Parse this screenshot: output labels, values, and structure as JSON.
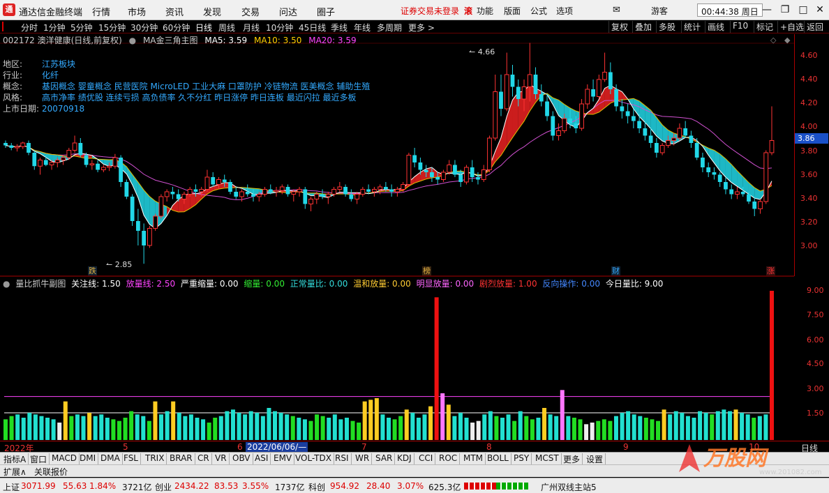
{
  "menubar": {
    "logo": "通",
    "title": "通达信金融终端",
    "items": [
      "行情",
      "市场",
      "资讯",
      "发现",
      "交易",
      "问达",
      "圈子"
    ],
    "warning": "证券交易未登录",
    "func_badge": "滚",
    "right_items": [
      "功能",
      "版面",
      "公式",
      "选项",
      "游客"
    ],
    "clock": "00:44:38 周日"
  },
  "toolbar": {
    "periods": [
      "分时",
      "1分钟",
      "5分钟",
      "15分钟",
      "30分钟",
      "60分钟",
      "日线",
      "周线",
      "月线",
      "10分钟",
      "45日线",
      "季线",
      "年线",
      "多周期",
      "更多 >"
    ],
    "active": "日线",
    "right": [
      "复权",
      "叠加",
      "多股",
      "统计",
      "画线",
      "F10",
      "标记",
      "+自选",
      "返回"
    ]
  },
  "mainhead": {
    "stock": "002172 澳洋健康(日线,前复权)",
    "indicator": "MA金三角主图",
    "ma5": "MA5: 3.59",
    "ma10": "MA10: 3.50",
    "ma20": "MA20: 3.59"
  },
  "info": {
    "rows": [
      {
        "k": "地区:",
        "v": "江苏板块"
      },
      {
        "k": "行业:",
        "v": "化纤"
      },
      {
        "k": "概念:",
        "v": "基因概念 婴童概念 民营医院 MicroLED 工业大麻 口罩防护 冷链物流 医美概念 辅助生殖"
      },
      {
        "k": "风格:",
        "v": "高市净率 绩优股 连续亏损 高负债率 久不分红 昨日涨停 昨日连板 最近闪拉 最近多板"
      },
      {
        "k": "上市日期:",
        "v": "20070918"
      }
    ]
  },
  "price_axis": {
    "ticks": [
      "4.60",
      "4.40",
      "4.20",
      "4.00",
      "3.80",
      "3.60",
      "3.40",
      "3.20",
      "3.00"
    ],
    "current": "3.86",
    "high_label": "4.66",
    "low_label": "2.85"
  },
  "markers": [
    {
      "text": "跌",
      "color": "#e0b040"
    },
    {
      "text": "榜",
      "color": "#e0b040"
    },
    {
      "text": "财",
      "color": "#33aaff"
    },
    {
      "text": "涨",
      "color": "#ff3333"
    }
  ],
  "subhead": {
    "name": "量比抓牛副图",
    "items": [
      {
        "t": "关注线: 1.50",
        "c": "#ffffff"
      },
      {
        "t": "放量线: 2.50",
        "c": "#ff44ff"
      },
      {
        "t": "严重缩量: 0.00",
        "c": "#ffffff"
      },
      {
        "t": "缩量: 0.00",
        "c": "#33ee33"
      },
      {
        "t": "正常量比: 0.00",
        "c": "#33dddd"
      },
      {
        "t": "温和放量: 0.00",
        "c": "#ffcc33"
      },
      {
        "t": "明显放量: 0.00",
        "c": "#ff66ff"
      },
      {
        "t": "剧烈放量: 1.00",
        "c": "#ff3333"
      },
      {
        "t": "反向操作: 0.00",
        "c": "#4488ff"
      },
      {
        "t": "今日量比: 9.00",
        "c": "#ffffff"
      }
    ]
  },
  "vol_axis": {
    "ticks": [
      "9.00",
      "7.50",
      "6.00",
      "4.50",
      "3.00",
      "1.50"
    ]
  },
  "date_axis": {
    "labels": [
      "2022年",
      "5",
      "6",
      "7",
      "8",
      "9",
      "10"
    ],
    "cursor": "2022/06/06/—",
    "period": "日线"
  },
  "indicators": [
    "指标A",
    "窗口",
    "MACD",
    "DMI",
    "DMA",
    "FSL",
    "TRIX",
    "BRAR",
    "CR",
    "VR",
    "OBV",
    "ASI",
    "EMV",
    "VOL-TDX",
    "RSI",
    "WR",
    "SAR",
    "KDJ",
    "CCI",
    "ROC",
    "MTM",
    "BOLL",
    "PSY",
    "MCST",
    "更多",
    "设置"
  ],
  "extbar": [
    "扩展∧",
    "关联报价"
  ],
  "status": {
    "sh_name": "上证",
    "sh_val": "3071.99",
    "sh_chg": "55.63",
    "sh_pct": "1.84%",
    "sh_amt": "3721亿",
    "cy_name": "创业",
    "cy_val": "2434.22",
    "cy_chg": "83.53",
    "cy_pct": "3.55%",
    "cy_amt": "1737亿",
    "kc_name": "科创",
    "kc_val": "954.92",
    "kc_chg": "28.40",
    "kc_pct": "3.07%",
    "kc_amt": "625.3亿",
    "server": "广州双线主站5"
  },
  "watermark": {
    "text": "万股网",
    "url": "www.201082.com"
  },
  "chart_data": {
    "type": "candlestick",
    "ylim": [
      2.8,
      4.7
    ],
    "candles": [
      [
        3.84,
        3.86,
        3.8,
        3.82
      ],
      [
        3.82,
        3.84,
        3.78,
        3.8
      ],
      [
        3.8,
        3.83,
        3.77,
        3.81
      ],
      [
        3.81,
        3.85,
        3.79,
        3.84
      ],
      [
        3.84,
        3.86,
        3.74,
        3.76
      ],
      [
        3.76,
        3.78,
        3.62,
        3.65
      ],
      [
        3.65,
        3.72,
        3.58,
        3.7
      ],
      [
        3.7,
        3.74,
        3.65,
        3.66
      ],
      [
        3.66,
        3.7,
        3.62,
        3.68
      ],
      [
        3.68,
        3.72,
        3.64,
        3.7
      ],
      [
        3.7,
        3.74,
        3.66,
        3.72
      ],
      [
        3.72,
        3.8,
        3.7,
        3.78
      ],
      [
        3.78,
        3.9,
        3.76,
        3.84
      ],
      [
        3.84,
        3.88,
        3.72,
        3.74
      ],
      [
        3.74,
        3.76,
        3.64,
        3.66
      ],
      [
        3.66,
        3.7,
        3.62,
        3.67
      ],
      [
        3.67,
        3.7,
        3.6,
        3.62
      ],
      [
        3.62,
        3.66,
        3.6,
        3.64
      ],
      [
        3.64,
        3.68,
        3.61,
        3.65
      ],
      [
        3.65,
        3.75,
        3.63,
        3.72
      ],
      [
        3.72,
        3.74,
        3.48,
        3.52
      ],
      [
        3.52,
        3.54,
        3.38,
        3.4
      ],
      [
        3.4,
        3.42,
        3.16,
        3.2
      ],
      [
        3.2,
        3.3,
        3.0,
        3.12
      ],
      [
        3.12,
        3.18,
        2.85,
        3.0
      ],
      [
        3.0,
        3.16,
        2.98,
        3.14
      ],
      [
        3.14,
        3.26,
        3.12,
        3.24
      ],
      [
        3.24,
        3.42,
        3.22,
        3.4
      ],
      [
        3.4,
        3.46,
        3.36,
        3.44
      ],
      [
        3.44,
        3.48,
        3.38,
        3.42
      ],
      [
        3.42,
        3.46,
        3.36,
        3.38
      ],
      [
        3.38,
        3.44,
        3.34,
        3.42
      ],
      [
        3.42,
        3.48,
        3.4,
        3.46
      ],
      [
        3.46,
        3.5,
        3.4,
        3.44
      ],
      [
        3.44,
        3.48,
        3.4,
        3.46
      ],
      [
        3.46,
        3.62,
        3.44,
        3.56
      ],
      [
        3.56,
        3.6,
        3.48,
        3.5
      ],
      [
        3.5,
        3.56,
        3.46,
        3.54
      ],
      [
        3.54,
        3.58,
        3.48,
        3.52
      ],
      [
        3.52,
        3.54,
        3.42,
        3.44
      ],
      [
        3.44,
        3.48,
        3.38,
        3.4
      ],
      [
        3.4,
        3.46,
        3.36,
        3.44
      ],
      [
        3.44,
        3.5,
        3.4,
        3.42
      ],
      [
        3.42,
        3.46,
        3.36,
        3.4
      ],
      [
        3.4,
        3.44,
        3.36,
        3.42
      ],
      [
        3.42,
        3.48,
        3.4,
        3.46
      ],
      [
        3.46,
        3.5,
        3.42,
        3.44
      ],
      [
        3.44,
        3.48,
        3.4,
        3.45
      ],
      [
        3.45,
        3.5,
        3.42,
        3.48
      ],
      [
        3.48,
        3.5,
        3.4,
        3.42
      ],
      [
        3.42,
        3.46,
        3.36,
        3.44
      ],
      [
        3.44,
        3.48,
        3.4,
        3.46
      ],
      [
        3.46,
        3.48,
        3.3,
        3.34
      ],
      [
        3.34,
        3.4,
        3.28,
        3.38
      ],
      [
        3.38,
        3.44,
        3.34,
        3.42
      ],
      [
        3.42,
        3.46,
        3.38,
        3.4
      ],
      [
        3.4,
        3.44,
        3.34,
        3.42
      ],
      [
        3.42,
        3.48,
        3.4,
        3.46
      ],
      [
        3.46,
        3.52,
        3.44,
        3.48
      ],
      [
        3.48,
        3.5,
        3.4,
        3.42
      ],
      [
        3.42,
        3.46,
        3.36,
        3.38
      ],
      [
        3.38,
        3.44,
        3.34,
        3.42
      ],
      [
        3.42,
        3.48,
        3.4,
        3.46
      ],
      [
        3.46,
        3.5,
        3.42,
        3.44
      ],
      [
        3.44,
        3.48,
        3.4,
        3.46
      ],
      [
        3.46,
        3.5,
        3.42,
        3.48
      ],
      [
        3.48,
        3.52,
        3.44,
        3.46
      ],
      [
        3.46,
        3.5,
        3.4,
        3.44
      ],
      [
        3.44,
        3.48,
        3.4,
        3.46
      ],
      [
        3.46,
        3.52,
        3.44,
        3.5
      ],
      [
        3.5,
        3.76,
        3.48,
        3.74
      ],
      [
        3.74,
        3.8,
        3.64,
        3.68
      ],
      [
        3.68,
        3.72,
        3.58,
        3.62
      ],
      [
        3.62,
        3.66,
        3.56,
        3.6
      ],
      [
        3.6,
        3.64,
        3.52,
        3.56
      ],
      [
        3.56,
        3.6,
        3.5,
        3.54
      ],
      [
        3.54,
        3.62,
        3.52,
        3.6
      ],
      [
        3.6,
        3.7,
        3.58,
        3.66
      ],
      [
        3.66,
        3.7,
        3.56,
        3.58
      ],
      [
        3.58,
        3.62,
        3.48,
        3.52
      ],
      [
        3.52,
        3.66,
        3.5,
        3.64
      ],
      [
        3.64,
        3.7,
        3.52,
        3.56
      ],
      [
        3.56,
        3.6,
        3.5,
        3.54
      ],
      [
        3.54,
        3.66,
        3.52,
        3.62
      ],
      [
        3.62,
        3.9,
        3.6,
        3.88
      ],
      [
        3.88,
        4.4,
        3.86,
        4.26
      ],
      [
        4.26,
        4.4,
        4.06,
        4.12
      ],
      [
        4.12,
        4.58,
        4.1,
        4.4
      ],
      [
        4.4,
        4.48,
        4.22,
        4.3
      ],
      [
        4.3,
        4.36,
        4.14,
        4.2
      ],
      [
        4.2,
        4.36,
        4.1,
        4.3
      ],
      [
        4.3,
        4.66,
        4.18,
        4.4
      ],
      [
        4.4,
        4.46,
        4.2,
        4.24
      ],
      [
        4.24,
        4.32,
        4.14,
        4.18
      ],
      [
        4.18,
        4.24,
        4.02,
        4.06
      ],
      [
        4.06,
        4.1,
        3.86,
        3.9
      ],
      [
        3.9,
        4.0,
        3.86,
        3.94
      ],
      [
        3.94,
        4.08,
        3.92,
        4.04
      ],
      [
        4.04,
        4.12,
        3.96,
        4.0
      ],
      [
        4.0,
        4.06,
        3.92,
        3.96
      ],
      [
        3.96,
        4.2,
        3.94,
        4.16
      ],
      [
        4.16,
        4.32,
        4.12,
        4.28
      ],
      [
        4.28,
        4.36,
        4.18,
        4.22
      ],
      [
        4.22,
        4.4,
        4.2,
        4.36
      ],
      [
        4.36,
        4.58,
        4.34,
        4.42
      ],
      [
        4.42,
        4.5,
        4.24,
        4.28
      ],
      [
        4.28,
        4.32,
        4.1,
        4.14
      ],
      [
        4.14,
        4.2,
        4.04,
        4.1
      ],
      [
        4.1,
        4.16,
        4.0,
        4.06
      ],
      [
        4.06,
        4.12,
        3.96,
        4.02
      ],
      [
        4.02,
        4.08,
        3.92,
        3.96
      ],
      [
        3.96,
        4.02,
        3.86,
        3.9
      ],
      [
        3.9,
        3.96,
        3.8,
        3.84
      ],
      [
        3.84,
        3.88,
        3.72,
        3.76
      ],
      [
        3.76,
        3.84,
        3.74,
        3.82
      ],
      [
        3.82,
        3.9,
        3.8,
        3.86
      ],
      [
        3.86,
        3.92,
        3.82,
        3.88
      ],
      [
        3.88,
        4.0,
        3.86,
        3.96
      ],
      [
        3.96,
        4.02,
        3.88,
        3.9
      ],
      [
        3.9,
        3.94,
        3.8,
        3.84
      ],
      [
        3.84,
        3.88,
        3.7,
        3.72
      ],
      [
        3.72,
        3.76,
        3.6,
        3.64
      ],
      [
        3.64,
        3.68,
        3.56,
        3.6
      ],
      [
        3.6,
        3.64,
        3.54,
        3.58
      ],
      [
        3.58,
        3.6,
        3.48,
        3.52
      ],
      [
        3.52,
        3.56,
        3.42,
        3.46
      ],
      [
        3.46,
        3.5,
        3.38,
        3.42
      ],
      [
        3.42,
        3.48,
        3.38,
        3.44
      ],
      [
        3.44,
        3.48,
        3.4,
        3.42
      ],
      [
        3.42,
        3.44,
        3.34,
        3.36
      ],
      [
        3.36,
        3.4,
        3.24,
        3.3
      ],
      [
        3.3,
        3.38,
        3.26,
        3.36
      ],
      [
        3.36,
        3.78,
        3.34,
        3.76
      ],
      [
        3.76,
        4.14,
        3.74,
        3.86
      ]
    ],
    "ratio": [
      [
        1.1,
        "g"
      ],
      [
        1.3,
        "g"
      ],
      [
        1.4,
        "c"
      ],
      [
        1.2,
        "c"
      ],
      [
        1.5,
        "c"
      ],
      [
        1.4,
        "c"
      ],
      [
        1.3,
        "c"
      ],
      [
        1.2,
        "c"
      ],
      [
        1.1,
        "c"
      ],
      [
        0.9,
        "w"
      ],
      [
        2.2,
        "y"
      ],
      [
        1.3,
        "g"
      ],
      [
        1.4,
        "c"
      ],
      [
        1.3,
        "c"
      ],
      [
        1.5,
        "y"
      ],
      [
        1.3,
        "c"
      ],
      [
        1.4,
        "c"
      ],
      [
        1.2,
        "c"
      ],
      [
        1.1,
        "g"
      ],
      [
        1.0,
        "g"
      ],
      [
        1.2,
        "g"
      ],
      [
        1.6,
        "g"
      ],
      [
        1.4,
        "c"
      ],
      [
        1.3,
        "c"
      ],
      [
        1.0,
        "g"
      ],
      [
        2.2,
        "y"
      ],
      [
        1.4,
        "c"
      ],
      [
        1.6,
        "c"
      ],
      [
        2.2,
        "y"
      ],
      [
        1.5,
        "c"
      ],
      [
        1.3,
        "c"
      ],
      [
        1.4,
        "c"
      ],
      [
        1.2,
        "c"
      ],
      [
        1.1,
        "c"
      ],
      [
        0.9,
        "g"
      ],
      [
        1.2,
        "g"
      ],
      [
        1.3,
        "c"
      ],
      [
        1.6,
        "c"
      ],
      [
        1.7,
        "c"
      ],
      [
        1.5,
        "c"
      ],
      [
        1.4,
        "c"
      ],
      [
        1.6,
        "c"
      ],
      [
        1.5,
        "c"
      ],
      [
        1.3,
        "c"
      ],
      [
        1.8,
        "c"
      ],
      [
        1.6,
        "c"
      ],
      [
        1.5,
        "c"
      ],
      [
        1.4,
        "c"
      ],
      [
        1.3,
        "g"
      ],
      [
        1.2,
        "c"
      ],
      [
        1.1,
        "c"
      ],
      [
        1.0,
        "g"
      ],
      [
        1.4,
        "g"
      ],
      [
        1.3,
        "g"
      ],
      [
        1.2,
        "c"
      ],
      [
        1.4,
        "c"
      ],
      [
        1.1,
        "c"
      ],
      [
        1.2,
        "c"
      ],
      [
        1.0,
        "g"
      ],
      [
        0.9,
        "g"
      ],
      [
        2.2,
        "y"
      ],
      [
        2.3,
        "y"
      ],
      [
        2.4,
        "y"
      ],
      [
        1.4,
        "c"
      ],
      [
        1.2,
        "c"
      ],
      [
        1.1,
        "g"
      ],
      [
        1.3,
        "g"
      ],
      [
        1.7,
        "y"
      ],
      [
        1.5,
        "c"
      ],
      [
        1.2,
        "c"
      ],
      [
        1.4,
        "c"
      ],
      [
        1.9,
        "y"
      ],
      [
        8.6,
        "r"
      ],
      [
        2.7,
        "p"
      ],
      [
        2.0,
        "y"
      ],
      [
        1.3,
        "c"
      ],
      [
        1.5,
        "c"
      ],
      [
        1.2,
        "c"
      ],
      [
        0.9,
        "w"
      ],
      [
        1.0,
        "w"
      ],
      [
        1.4,
        "c"
      ],
      [
        1.6,
        "c"
      ],
      [
        1.3,
        "g"
      ],
      [
        1.2,
        "c"
      ],
      [
        1.4,
        "c"
      ],
      [
        1.0,
        "g"
      ],
      [
        1.6,
        "c"
      ],
      [
        1.3,
        "g"
      ],
      [
        1.1,
        "g"
      ],
      [
        1.2,
        "c"
      ],
      [
        1.8,
        "y"
      ],
      [
        1.4,
        "c"
      ],
      [
        1.3,
        "c"
      ],
      [
        2.9,
        "p"
      ],
      [
        1.3,
        "c"
      ],
      [
        1.2,
        "g"
      ],
      [
        1.1,
        "g"
      ],
      [
        0.8,
        "w"
      ],
      [
        0.9,
        "w"
      ],
      [
        1.0,
        "g"
      ],
      [
        1.1,
        "g"
      ],
      [
        1.0,
        "g"
      ],
      [
        1.3,
        "c"
      ],
      [
        1.5,
        "c"
      ],
      [
        1.6,
        "c"
      ],
      [
        1.4,
        "c"
      ],
      [
        1.3,
        "c"
      ],
      [
        1.2,
        "g"
      ],
      [
        1.1,
        "g"
      ],
      [
        1.0,
        "g"
      ],
      [
        1.7,
        "y"
      ],
      [
        1.4,
        "c"
      ],
      [
        1.6,
        "c"
      ],
      [
        1.5,
        "c"
      ],
      [
        1.3,
        "c"
      ],
      [
        1.2,
        "c"
      ],
      [
        1.6,
        "c"
      ],
      [
        1.5,
        "c"
      ],
      [
        1.4,
        "g"
      ],
      [
        1.6,
        "c"
      ],
      [
        1.7,
        "c"
      ],
      [
        1.6,
        "c"
      ],
      [
        1.7,
        "y"
      ],
      [
        1.5,
        "c"
      ],
      [
        1.4,
        "c"
      ],
      [
        1.2,
        "g"
      ],
      [
        1.3,
        "c"
      ],
      [
        1.4,
        "c"
      ],
      [
        9.0,
        "r"
      ]
    ]
  }
}
